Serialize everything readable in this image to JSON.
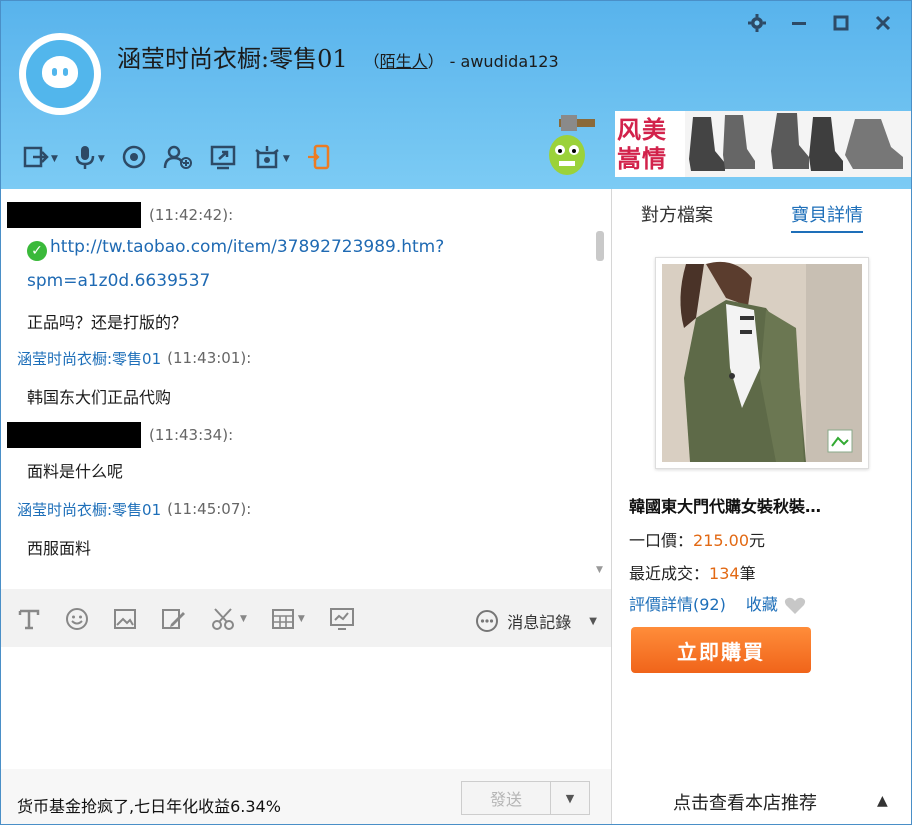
{
  "header": {
    "title": "涵莹时尚衣橱:零售01",
    "status_open": "（",
    "status_link": "陌生人",
    "status_close": "）",
    "user": "- awudida123",
    "ad_text": "风美嵩情"
  },
  "toolbar": {
    "icons": [
      "transfer-file-icon",
      "voice-icon",
      "video-icon",
      "add-contact-icon",
      "share-screen-icon",
      "remote-help-icon",
      "mobile-icon"
    ]
  },
  "messages": [
    {
      "redacted": true,
      "time": "(11:42:42):",
      "link": "http://tw.taobao.com/item/37892723989.htm?",
      "link2": "spm=a1z0d.6639537",
      "text": "正品吗？还是打版的？"
    },
    {
      "sender": "涵莹时尚衣橱:零售01",
      "time": "(11:43:01):",
      "text": "韩国东大们正品代购"
    },
    {
      "redacted": true,
      "time": "(11:43:34):",
      "text": "面料是什么呢"
    },
    {
      "sender": "涵莹时尚衣橱:零售01",
      "time": "(11:45:07):",
      "text": "西服面料"
    }
  ],
  "input_toolbar": {
    "history_label": "消息記錄"
  },
  "bottom": {
    "promo_text": "货币基金抢疯了,七日年化收益6.34%",
    "send_label": "發送"
  },
  "panel": {
    "tab_profile": "對方檔案",
    "tab_item": "寶貝詳情",
    "product_name": "韓國東大門代購女裝秋裝…",
    "price_label": "一口價：",
    "price_value": "215.00",
    "price_unit": "元",
    "sold_label": "最近成交：",
    "sold_value": "134",
    "sold_unit": "筆",
    "review_link": "評價詳情(92)",
    "fav_link": "收藏",
    "buy_label": "立即購買",
    "shop_rec": "点击查看本店推荐"
  },
  "colors": {
    "header_blue": "#58b3ec",
    "link_blue": "#1e6fb9",
    "price_orange": "#e26914",
    "buy_orange": "#f0641a"
  }
}
